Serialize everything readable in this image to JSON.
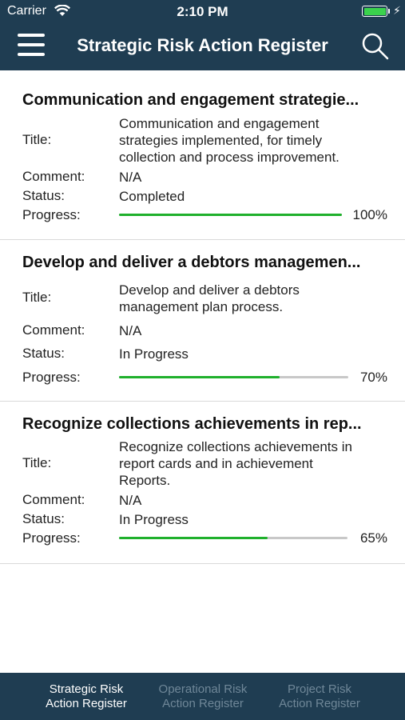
{
  "status_bar": {
    "carrier": "Carrier",
    "time": "2:10 PM"
  },
  "nav": {
    "title": "Strategic Risk Action Register"
  },
  "labels": {
    "title": "Title:",
    "comment": "Comment:",
    "status": "Status:",
    "progress": "Progress:"
  },
  "items": [
    {
      "heading": "Communication and engagement strategie...",
      "title_lines": [
        "Communication and engagement",
        "strategies implemented, for timely",
        "collection and process improvement."
      ],
      "comment": "N/A",
      "status": "Completed",
      "progress": 1.0,
      "progress_text": "100%"
    },
    {
      "heading": "Develop and deliver a debtors managemen...",
      "title_lines": [
        "Develop and deliver a debtors",
        "management plan process."
      ],
      "comment": "N/A",
      "status": "In Progress",
      "progress": 0.7,
      "progress_text": "70%"
    },
    {
      "heading": "Recognize collections  achievements in rep...",
      "title_lines": [
        "Recognize collections  achievements in",
        "report cards and in achievement",
        "Reports."
      ],
      "comment": "N/A",
      "status": "In Progress",
      "progress": 0.65,
      "progress_text": "65%"
    }
  ],
  "tabs": [
    {
      "label": "Strategic Risk\nAction Register",
      "active": true
    },
    {
      "label": "Operational Risk\nAction Register",
      "active": false
    },
    {
      "label": "Project Risk\nAction Register",
      "active": false
    }
  ],
  "colors": {
    "header": "#1f3d52",
    "progress_fill": "#1fb02c",
    "progress_track": "#c8c8c8",
    "battery": "#3ad24d"
  }
}
